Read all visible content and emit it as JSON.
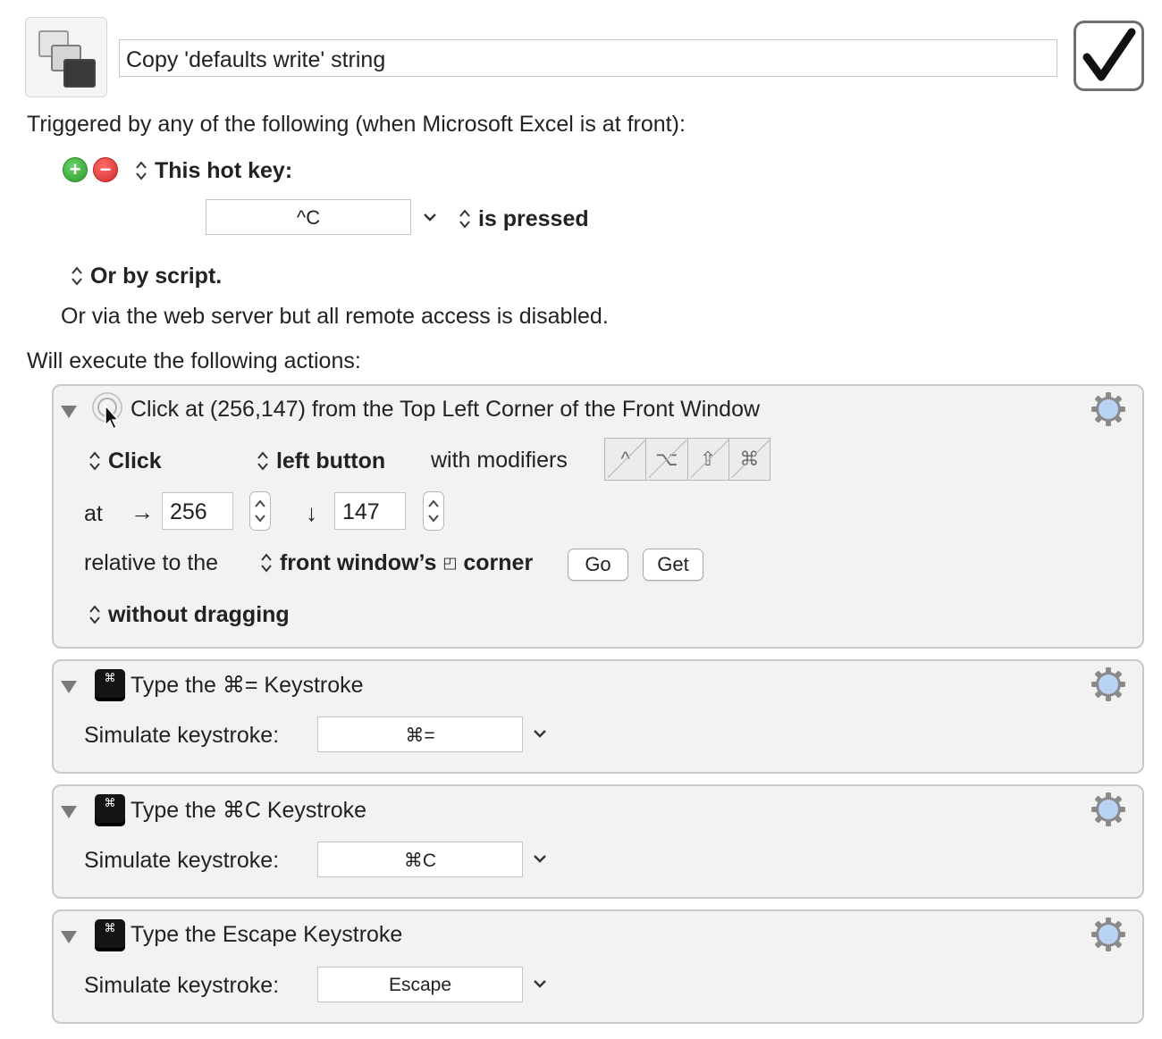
{
  "macro": {
    "name": "Copy 'defaults write' string",
    "enabled_glyph": "✓",
    "enabled": true
  },
  "trigger": {
    "heading": "Triggered by any of the following (when Microsoft Excel is at front):",
    "hotkey_label": "This hot key:",
    "hotkey_value": "^C",
    "hotkey_condition": "is pressed",
    "script_label": "Or by script.",
    "web_server_text": "Or via the web server but all remote access is disabled."
  },
  "actions_heading": "Will execute the following actions:",
  "click_action": {
    "title": "Click at (256,147) from the Top Left Corner of the Front Window",
    "click_type": "Click",
    "button": "left button",
    "modifiers_label": "with modifiers",
    "modifiers": [
      "^",
      "⌥",
      "⇧",
      "⌘"
    ],
    "at_label": "at",
    "x_arrow": "→",
    "x_value": "256",
    "y_arrow": "↓",
    "y_value": "147",
    "relative_label": "relative to the",
    "relative_value_a": "front window’s",
    "relative_value_b": "corner",
    "corner_glyph": "◰",
    "go_label": "Go",
    "get_label": "Get",
    "drag_mode": "without dragging"
  },
  "keystroke_actions": [
    {
      "title": "Type the ⌘= Keystroke",
      "label": "Simulate keystroke:",
      "value": "⌘=",
      "icon_glyph": "⌘"
    },
    {
      "title": "Type the ⌘C Keystroke",
      "label": "Simulate keystroke:",
      "value": "⌘C",
      "icon_glyph": "⌘"
    },
    {
      "title": "Type the Escape Keystroke",
      "label": "Simulate keystroke:",
      "value": "Escape",
      "icon_glyph": "⌘"
    }
  ],
  "icons": {
    "macro": "macro-windows-icon",
    "add": "plus-circle-icon",
    "remove": "minus-circle-icon",
    "gear": "gear-icon",
    "disclosure": "disclosure-triangle-icon",
    "click": "mouse-click-icon",
    "keystroke": "keyboard-key-icon"
  },
  "colors": {
    "add_green": "#2d9a2d",
    "remove_red": "#d42a2a",
    "gear_blue": "#a9c8f0",
    "panel_bg": "#f2f2f2"
  }
}
